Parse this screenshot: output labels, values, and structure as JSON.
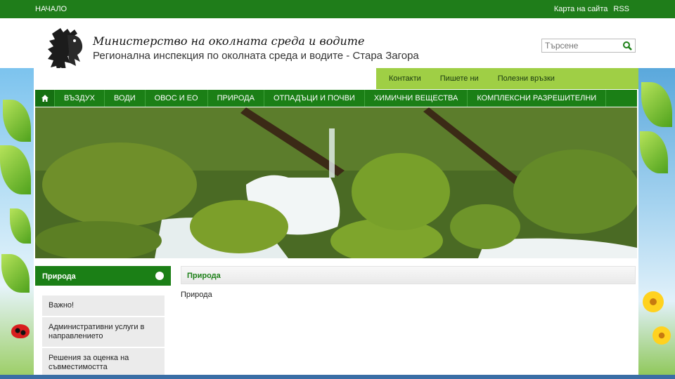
{
  "topbar": {
    "home": "НАЧАЛО",
    "sitemap": "Карта на сайта",
    "rss": "RSS"
  },
  "header": {
    "title": "Министерство на околната среда и водите",
    "subtitle": "Регионална инспекция по околната среда и водите - Стара Загора"
  },
  "search": {
    "placeholder": "Търсене"
  },
  "sublinks": [
    "Контакти",
    "Пишете ни",
    "Полезни връзки"
  ],
  "nav": [
    "ВЪЗДУХ",
    "ВОДИ",
    "ОВОС И ЕО",
    "ПРИРОДА",
    "ОТПАДЪЦИ И ПОЧВИ",
    "ХИМИЧНИ ВЕЩЕСТВА",
    "КОМПЛЕКСНИ РАЗРЕШИТЕЛНИ"
  ],
  "sidebar": {
    "heading": "Природа",
    "items": [
      "Важно!",
      "Административни услуги в направлението",
      "Решения за оценка на съвместимостта"
    ]
  },
  "content": {
    "heading": "Природа",
    "body": "Природа"
  },
  "colors": {
    "primary_green": "#1b7f16",
    "light_green": "#9fcf45",
    "accent_text": "#1b7f16"
  },
  "icons": {
    "home": "home-icon",
    "search": "search-icon",
    "logo": "lion-coat-of-arms"
  }
}
